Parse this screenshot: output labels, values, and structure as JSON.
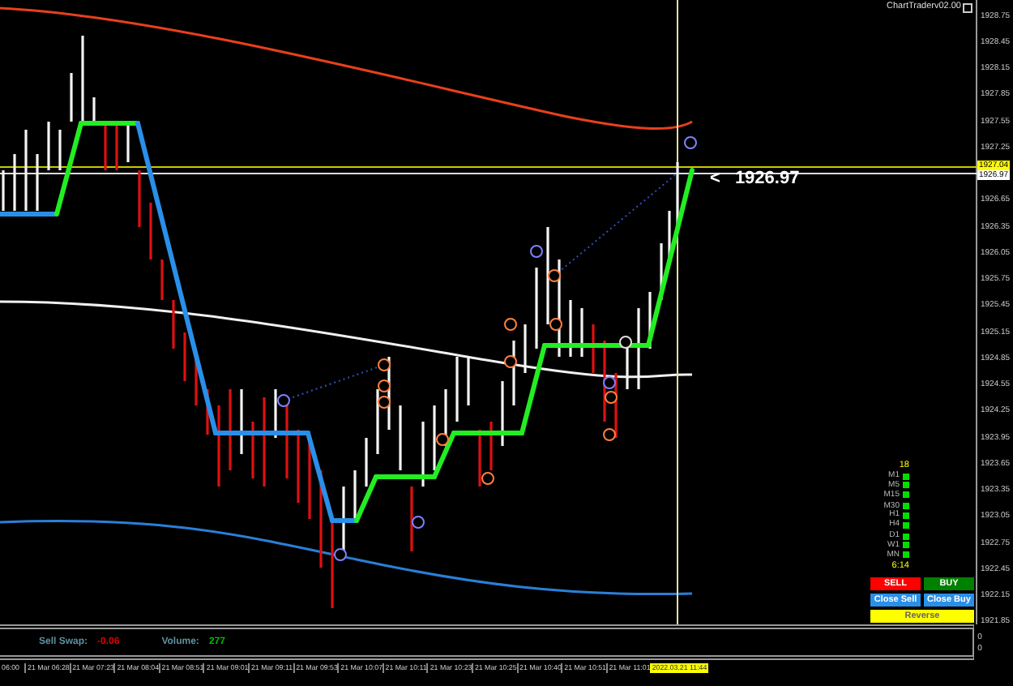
{
  "chart_header": {
    "title": "ChartTraderv02.00"
  },
  "price_axis": {
    "labels": [
      "1928.75",
      "1928.45",
      "1928.15",
      "1927.85",
      "1927.55",
      "1927.25",
      "1926.65",
      "1926.35",
      "1926.05",
      "1925.75",
      "1925.45",
      "1925.15",
      "1924.85",
      "1924.55",
      "1924.25",
      "1923.95",
      "1923.65",
      "1923.35",
      "1923.05",
      "1922.75",
      "1922.45",
      "1922.15",
      "1921.85"
    ],
    "markers": [
      {
        "text": "1927.04",
        "kind": "bid"
      },
      {
        "text": "1926.97",
        "kind": "ask"
      }
    ]
  },
  "price_callout": {
    "arrow": "<",
    "price": "1926.97"
  },
  "timeframe_panel": {
    "count": "18",
    "groups": [
      [
        "M1",
        "M5",
        "M15"
      ],
      [
        "M30",
        "H1",
        "H4"
      ],
      [
        "D1",
        "W1",
        "MN"
      ]
    ],
    "timer": "6:14"
  },
  "trade_buttons": [
    {
      "label": "SELL",
      "kind": "sell"
    },
    {
      "label": "BUY",
      "kind": "buy"
    },
    {
      "label": "Close Sell",
      "kind": "close"
    },
    {
      "label": "Close Buy",
      "kind": "close"
    },
    {
      "label": "Reverse",
      "kind": "reverse"
    }
  ],
  "subwindow": {
    "sell_swap_label": "Sell Swap:",
    "sell_swap": "-0.06",
    "volume_label": "Volume:",
    "volume": "277",
    "scale": [
      "0",
      "0"
    ]
  },
  "time_axis": {
    "labels": [
      "06:00",
      "21 Mar 06:28",
      "21 Mar 07:23",
      "21 Mar 08:04",
      "21 Mar 08:51",
      "21 Mar 09:01",
      "21 Mar 09:11",
      "21 Mar 09:53",
      "21 Mar 10:07",
      "21 Mar 10:11",
      "21 Mar 10:23",
      "21 Mar 10:25",
      "21 Mar 10:40",
      "21 Mar 10:51",
      "21 Mar 11:01"
    ],
    "cursor_label": "2022.03.21 11:44"
  }
}
